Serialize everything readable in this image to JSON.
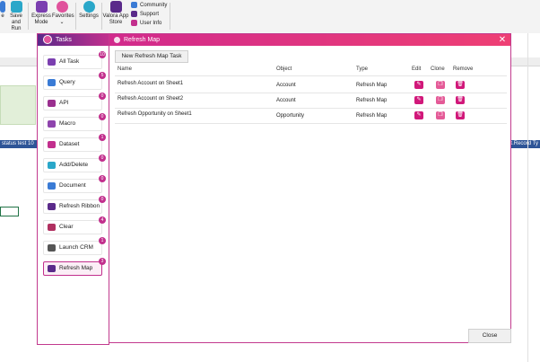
{
  "ribbon": {
    "run_label": "e",
    "save_run_label": "Save and Run",
    "express_mode_label": "Express Mode",
    "favorites_label": "Favorites",
    "settings_label": "Settings",
    "app_store_label": "Valora App Store",
    "community_label": "Community",
    "support_label": "Support",
    "user_info_label": "User Info"
  },
  "sheet": {
    "strip_left": "status  test 10",
    "strip_right": "t.Record Ty"
  },
  "tasks": {
    "title": "Tasks",
    "items": [
      {
        "label": "All Task",
        "badge": "10",
        "color": "#7b3fb0"
      },
      {
        "label": "Query",
        "badge": "5",
        "color": "#3a7bd5"
      },
      {
        "label": "API",
        "badge": "0",
        "color": "#9a2f8f"
      },
      {
        "label": "Macro",
        "badge": "0",
        "color": "#8e44ad"
      },
      {
        "label": "Dataset",
        "badge": "1",
        "color": "#c22f8d"
      },
      {
        "label": "Add/Delete",
        "badge": "0",
        "color": "#2aa7c9"
      },
      {
        "label": "Document",
        "badge": "0",
        "color": "#3a7bd5"
      },
      {
        "label": "Refresh Ribbon",
        "badge": "0",
        "color": "#5a2a8a"
      },
      {
        "label": "Clear",
        "badge": "4",
        "color": "#b03060"
      },
      {
        "label": "Launch CRM",
        "badge": "1",
        "color": "#555555"
      },
      {
        "label": "Refresh Map",
        "badge": "3",
        "color": "#5a2a8a"
      }
    ]
  },
  "dialog": {
    "title": "Refresh Map",
    "new_button": "New Refresh Map Task",
    "close_button": "Close",
    "columns": {
      "name": "Name",
      "object": "Object",
      "type": "Type",
      "edit": "Edit",
      "clone": "Clone",
      "remove": "Remove"
    },
    "rows": [
      {
        "name": "Refresh Account on Sheet1",
        "object": "Account",
        "type": "Refresh Map"
      },
      {
        "name": "Refresh Account on Sheet2",
        "object": "Account",
        "type": "Refresh Map"
      },
      {
        "name": "Refresh Opportunity on Sheet1",
        "object": "Opportunity",
        "type": "Refresh Map"
      }
    ]
  },
  "icons": {
    "edit": "pencil-icon",
    "clone": "copy-icon",
    "remove": "trash-icon",
    "close": "close-icon"
  }
}
